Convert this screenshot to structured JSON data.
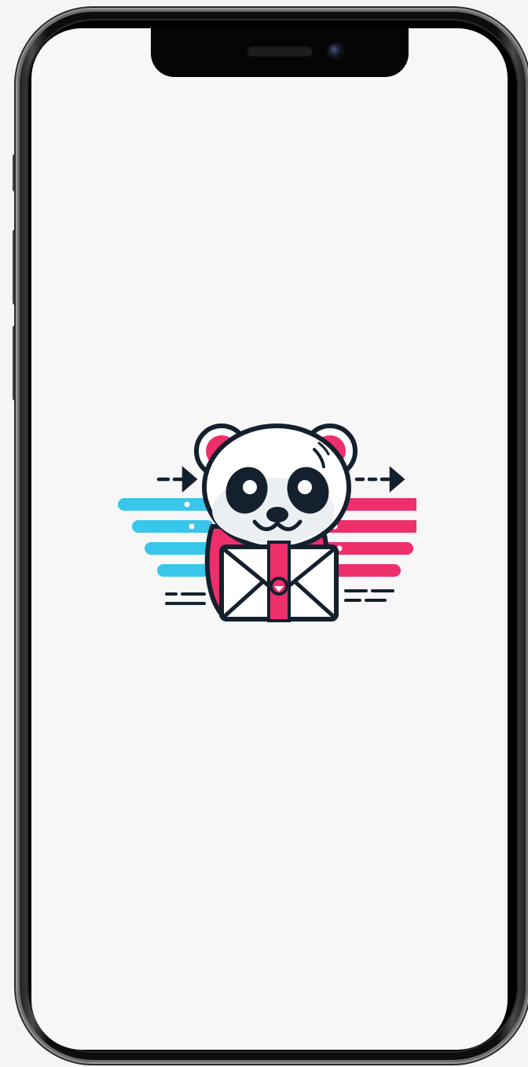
{
  "device": {
    "type": "smartphone-mockup",
    "frame_color": "#111111",
    "screen_color": "#f7f7f7"
  },
  "screen": {
    "content": "splash-logo",
    "logo": {
      "icon": "panda-envelope-logo-icon",
      "colors": {
        "cyan": "#38c6ea",
        "pink": "#ee2f6b",
        "outline": "#14202e",
        "face": "#ffffff"
      }
    }
  }
}
